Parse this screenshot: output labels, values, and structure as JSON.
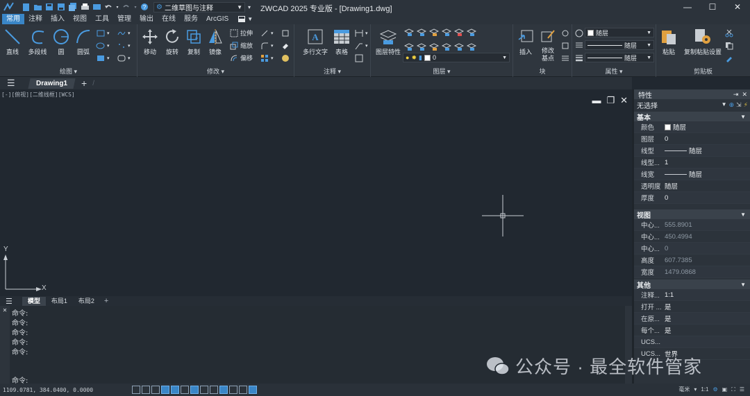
{
  "titlebar": {
    "workspace": "二维草图与注释",
    "app_title": "ZWCAD 2025 专业版 - [Drawing1.dwg]"
  },
  "ribbon_tabs": [
    "常用",
    "注释",
    "插入",
    "视图",
    "工具",
    "管理",
    "输出",
    "在线",
    "服务",
    "ArcGIS"
  ],
  "ribbon": {
    "draw": {
      "title": "绘图",
      "line": "直线",
      "polyline": "多段线",
      "circle": "圆",
      "arc": "圆弧"
    },
    "modify": {
      "title": "修改",
      "move": "移动",
      "rotate": "旋转",
      "copy": "复制",
      "mirror": "镜像",
      "stretch": "拉伸",
      "scale": "缩放",
      "offset": "偏移"
    },
    "annotation": {
      "title": "注释",
      "mtext": "多行文字",
      "table": "表格"
    },
    "layers": {
      "title": "图层",
      "layer_props": "图层特性",
      "current_layer": "0"
    },
    "block": {
      "title": "块",
      "insert": "插入",
      "basepoint": "修改基点"
    },
    "properties": {
      "title": "属性",
      "color": "随层",
      "linetype": "随层",
      "lineweight": "随层"
    },
    "clipboard": {
      "title": "剪贴板",
      "paste": "粘贴",
      "paste_settings": "复制粘贴设置"
    }
  },
  "doc_tab": "Drawing1",
  "canvas": {
    "view_label": "[-][俯视][二维线框][WCS]",
    "axis_x": "X",
    "axis_y": "Y"
  },
  "layout_tabs": [
    "模型",
    "布局1",
    "布局2"
  ],
  "command_lines": [
    "命令:",
    "命令:",
    "命令:",
    "命令:",
    "命令:"
  ],
  "command_prompt": "命令:",
  "status": {
    "coords": "1109.0781, 384.0400, 0.0000",
    "unit": "毫米",
    "scale": "1:1"
  },
  "properties": {
    "title": "特性",
    "selection": "无选择",
    "sections": {
      "basic": "基本",
      "view": "视图",
      "other": "其他"
    },
    "basic": [
      {
        "key": "颜色",
        "value": "随层"
      },
      {
        "key": "图层",
        "value": "0"
      },
      {
        "key": "线型",
        "value": "随层"
      },
      {
        "key": "线型...",
        "value": "1"
      },
      {
        "key": "线宽",
        "value": "随层"
      },
      {
        "key": "透明度",
        "value": "随层"
      },
      {
        "key": "厚度",
        "value": "0"
      }
    ],
    "view": [
      {
        "key": "中心...",
        "value": "555.8901"
      },
      {
        "key": "中心...",
        "value": "450.4994"
      },
      {
        "key": "中心...",
        "value": "0"
      },
      {
        "key": "高度",
        "value": "607.7385"
      },
      {
        "key": "宽度",
        "value": "1479.0868"
      }
    ],
    "other": [
      {
        "key": "注释...",
        "value": "1:1"
      },
      {
        "key": "打开 ...",
        "value": "是"
      },
      {
        "key": "在原...",
        "value": "是"
      },
      {
        "key": "每个...",
        "value": "是"
      },
      {
        "key": "UCS...",
        "value": ""
      },
      {
        "key": "UCS...",
        "value": "世界"
      }
    ]
  },
  "watermark": "公众号 · 最全软件管家",
  "colors": {
    "accent": "#3a86c7",
    "bg_canvas": "#212830",
    "panel": "#2f363e"
  }
}
